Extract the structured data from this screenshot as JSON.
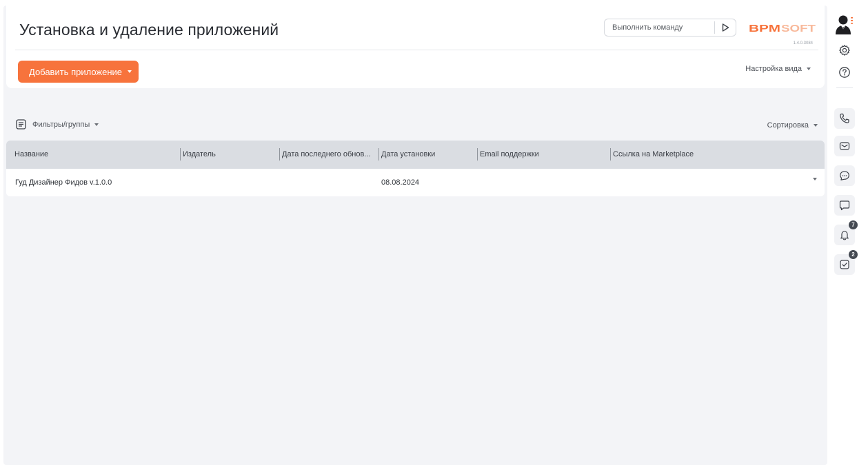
{
  "header": {
    "title": "Установка и удаление приложений",
    "command_placeholder": "Выполнить команду",
    "logo_text": "BPMSOFT",
    "version": "1.4.0.3084",
    "add_button_label": "Добавить приложение",
    "view_settings_label": "Настройка вида"
  },
  "toolbar": {
    "filters_label": "Фильтры/группы",
    "sorting_label": "Сортировка"
  },
  "table": {
    "columns": [
      "Название",
      "Издатель",
      "Дата последнего обнов...",
      "Дата установки",
      "Email поддержки",
      "Ссылка на Marketplace"
    ],
    "rows": [
      {
        "name": "Гуд Дизайнер Фидов v.1.0.0",
        "publisher": "",
        "last_update": "",
        "install_date": "08.08.2024",
        "support_email": "",
        "marketplace_link": ""
      }
    ]
  },
  "sidebar": {
    "icons": [
      "settings-icon",
      "help-icon",
      "phone-icon",
      "email-icon",
      "chat-icon",
      "feed-icon",
      "notifications-icon",
      "tasks-icon"
    ],
    "notifications_badge": "7",
    "tasks_badge": "2"
  },
  "colors": {
    "accent": "#f7733c",
    "header_row": "#dadde2",
    "background": "#f3f4f7"
  }
}
